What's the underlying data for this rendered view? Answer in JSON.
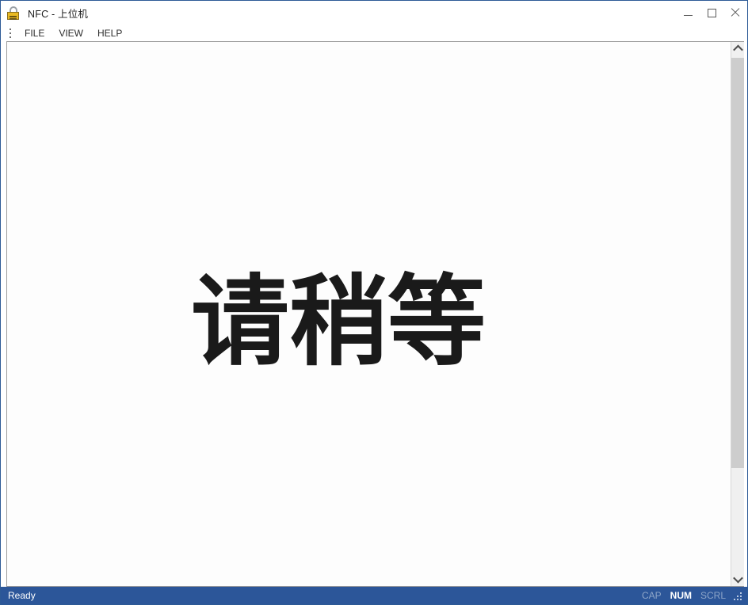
{
  "window": {
    "title": "NFC - 上位机",
    "icon": "padlock-icon",
    "border_color": "#2d5a96",
    "controls": {
      "minimize": "minimize-icon",
      "maximize": "maximize-icon",
      "close": "close-icon"
    }
  },
  "menubar": {
    "handle": "kebab-menu-icon",
    "items": [
      {
        "label": "FILE"
      },
      {
        "label": "VIEW"
      },
      {
        "label": "HELP"
      }
    ]
  },
  "client": {
    "background": "#fdfdfd",
    "message": "请稍等"
  },
  "scrollbar": {
    "up_arrow": "chevron-up-icon",
    "down_arrow": "chevron-down-icon",
    "track_color": "#f0f0f0",
    "thumb_color": "#cdcdcd"
  },
  "statusbar": {
    "background": "#2c5699",
    "status": "Ready",
    "indicators": [
      {
        "label": "CAP",
        "active": false
      },
      {
        "label": "NUM",
        "active": true
      },
      {
        "label": "SCRL",
        "active": false
      }
    ],
    "grip": "resize-grip-icon"
  }
}
